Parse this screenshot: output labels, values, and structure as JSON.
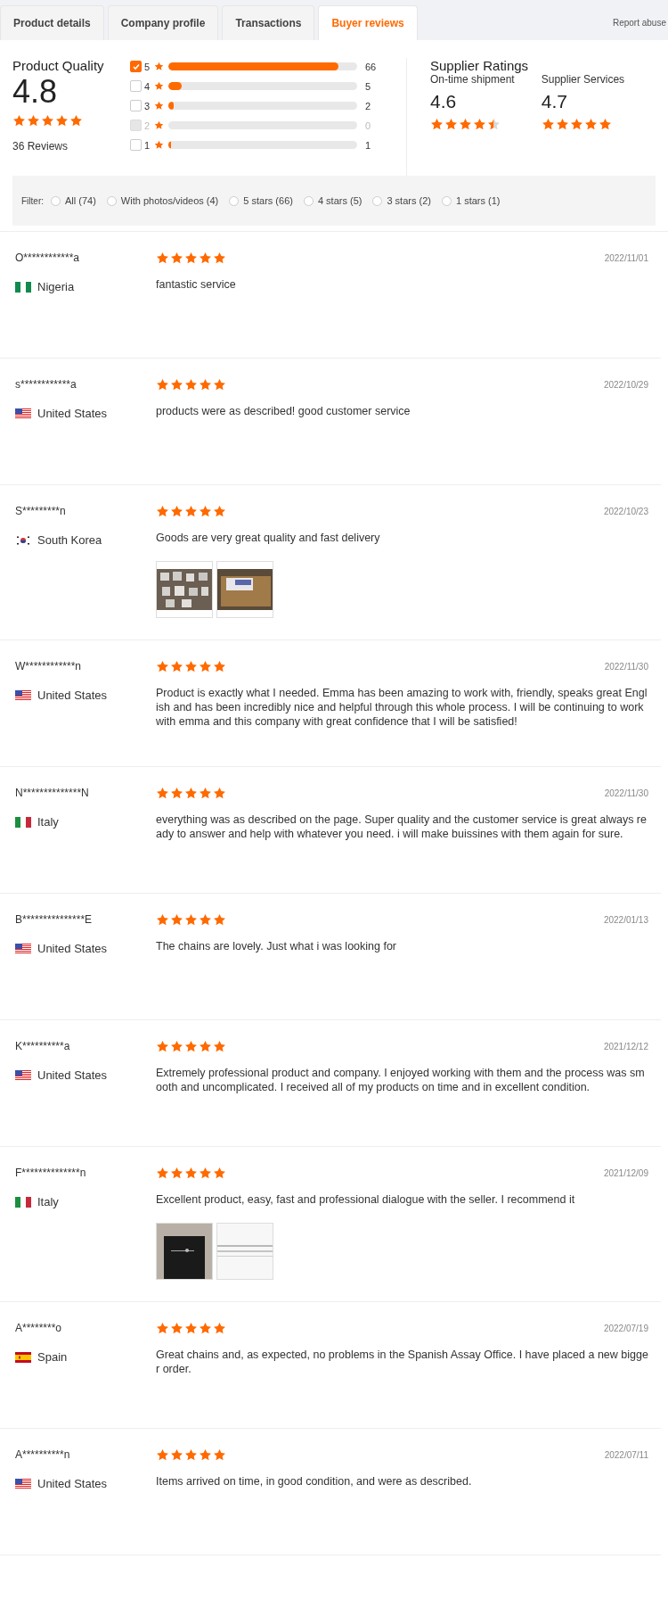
{
  "tabs": [
    {
      "label": "Product details",
      "selected": false
    },
    {
      "label": "Company profile",
      "selected": false
    },
    {
      "label": "Transactions",
      "selected": false
    },
    {
      "label": "Buyer reviews",
      "selected": true
    }
  ],
  "report_link": "Report abuse",
  "product_quality": {
    "title": "Product Quality",
    "score": "4.8",
    "stars": 5,
    "review_count": "36 Reviews"
  },
  "histogram": [
    {
      "label": "5",
      "checked": true,
      "disabled": false,
      "level": 0.9,
      "count": "66"
    },
    {
      "label": "4",
      "checked": false,
      "disabled": false,
      "level": 0.07,
      "count": "5"
    },
    {
      "label": "3",
      "checked": false,
      "disabled": false,
      "level": 0.03,
      "count": "2"
    },
    {
      "label": "2",
      "checked": false,
      "disabled": true,
      "level": 0,
      "count": "0"
    },
    {
      "label": "1",
      "checked": false,
      "disabled": false,
      "level": 0.015,
      "count": "1"
    }
  ],
  "supplier_ratings": {
    "title": "Supplier Ratings",
    "metrics": [
      {
        "label": "On-time shipment",
        "score": "4.6",
        "stars": 4.6
      },
      {
        "label": "Supplier Services",
        "score": "4.7",
        "stars": 5
      }
    ]
  },
  "filter": {
    "label": "Filter:",
    "options": [
      {
        "label": "All (74)",
        "selected": false
      },
      {
        "label": "With photos/videos (4)",
        "selected": false
      },
      {
        "label": "5 stars (66)",
        "selected": false
      },
      {
        "label": "4 stars (5)",
        "selected": false
      },
      {
        "label": "3 stars (2)",
        "selected": false
      },
      {
        "label": "1 stars (1)",
        "selected": false
      }
    ]
  },
  "reviews": [
    {
      "name": "O************a",
      "flag": {
        "kind": "ng"
      },
      "country": "Nigeria",
      "stars": 5,
      "date": "2022/11/01",
      "text": "fantastic service"
    },
    {
      "name": "s************a",
      "flag": {
        "kind": "us"
      },
      "country": "United States",
      "stars": 5,
      "date": "2022/10/29",
      "text": "products were as described! good customer service"
    },
    {
      "name": "S*********n",
      "flag": {
        "kind": "kr"
      },
      "country": "South Korea",
      "stars": 5,
      "date": "2022/10/23",
      "text": "Goods are very great quality and fast delivery",
      "photos": [
        {
          "kind": "picture"
        },
        {
          "kind": "picture"
        }
      ]
    },
    {
      "name": "W************n",
      "flag": {
        "kind": "us"
      },
      "country": "United States",
      "stars": 5,
      "date": "2022/11/30",
      "text": "Product is exactly what I needed. Emma has been amazing to work with, friendly, speaks great English and has been incredibly nice and helpful through this whole process. I will be continuing to work with emma and this company with great confidence that I will be satisfied!"
    },
    {
      "name": "N**************N",
      "flag": {
        "kind": "it"
      },
      "country": "Italy",
      "stars": 5,
      "date": "2022/11/30",
      "text": "everything was as described on the page. Super quality and the customer service is great always ready to answer and help with whatever you need. i will make buissines with them again for sure."
    },
    {
      "name": "B***************E",
      "flag": {
        "kind": "us"
      },
      "country": "United States",
      "stars": 5,
      "date": "2022/01/13",
      "text": "The chains are lovely. Just what i was looking for"
    },
    {
      "name": "K**********a",
      "flag": {
        "kind": "us"
      },
      "country": "United States",
      "stars": 5,
      "date": "2021/12/12",
      "text": "Extremely professional product and company. I enjoyed working with them and the process was smooth and uncomplicated. I received all of my products on time and in excellent condition."
    },
    {
      "name": "F**************n",
      "flag": {
        "kind": "it"
      },
      "country": "Italy",
      "stars": 5,
      "date": "2021/12/09",
      "text": "Excellent product, easy, fast and professional dialogue with the seller. I recommend it",
      "photos": [
        {
          "kind": "picture"
        },
        {
          "kind": "picture"
        }
      ]
    },
    {
      "name": "A********o",
      "flag": {
        "kind": "es"
      },
      "country": "Spain",
      "stars": 5,
      "date": "2022/07/19",
      "text": "Great chains and, as expected, no problems in the Spanish Assay Office. I have placed a new bigger order."
    },
    {
      "name": "A**********n",
      "flag": {
        "kind": "us"
      },
      "country": "United States",
      "stars": 5,
      "date": "2022/07/11",
      "text": "Items arrived on time, in good condition, and were as described."
    }
  ]
}
